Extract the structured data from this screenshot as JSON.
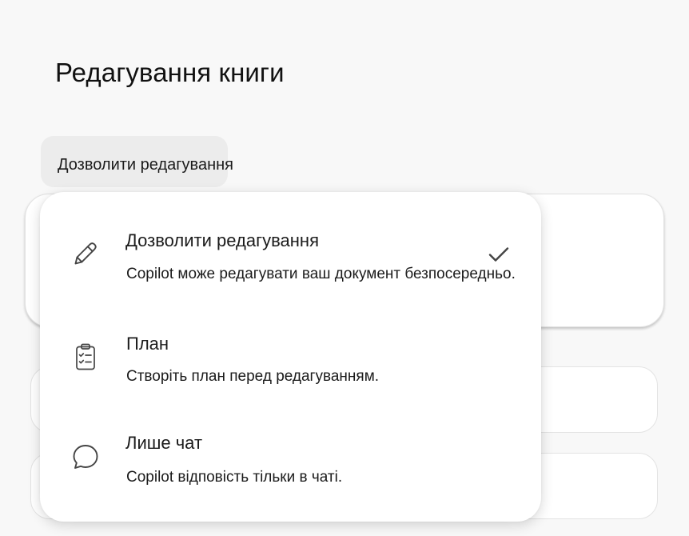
{
  "page": {
    "title": "Редагування книги"
  },
  "mode_button": {
    "label": "Дозволити редагування"
  },
  "menu": {
    "options": [
      {
        "icon": "pencil-icon",
        "title": "Дозволити редагування",
        "description": "Copilot може редагувати ваш документ безпосередньо.",
        "selected": true
      },
      {
        "icon": "clipboard-checklist-icon",
        "title": "План",
        "description": "Створіть план перед редагуванням.",
        "selected": false
      },
      {
        "icon": "chat-bubble-icon",
        "title": "Лише чат",
        "description": "Copilot відповість тільки в чаті.",
        "selected": false
      }
    ],
    "selected_indicator": "checkmark-icon"
  },
  "colors": {
    "background": "#f8f8f8",
    "surface": "#ffffff",
    "button_background": "#ececec",
    "text": "#1b1b1b",
    "icon_stroke": "#444444"
  }
}
